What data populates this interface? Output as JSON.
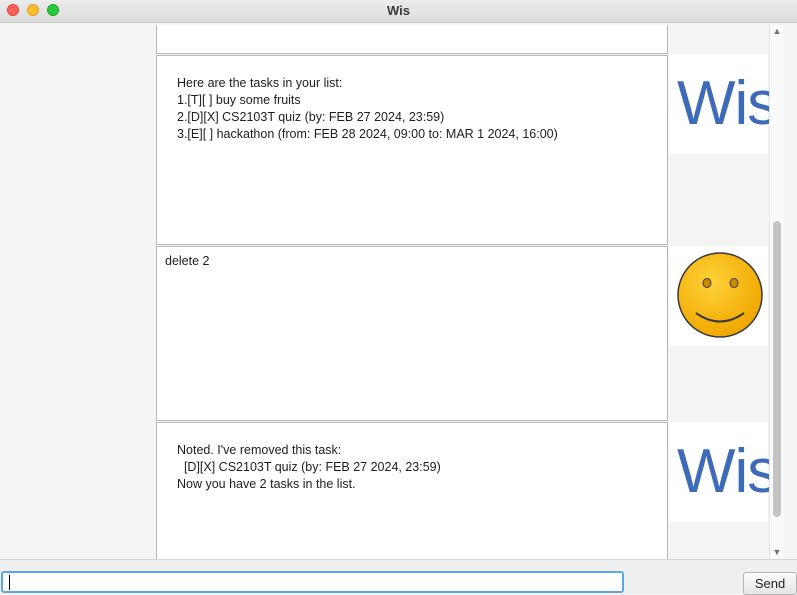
{
  "window": {
    "title": "Wis"
  },
  "rule_text": "____________________________________________________________",
  "messages": [
    {
      "type": "bot",
      "lines": []
    },
    {
      "type": "bot",
      "lines": [
        "Here are the tasks in your list:",
        "1.[T][ ] buy some fruits",
        "2.[D][X] CS2103T quiz (by: FEB 27 2024, 23:59)",
        "3.[E][ ] hackathon (from: FEB 28 2024, 09:00 to: MAR 1 2024, 16:00)"
      ]
    },
    {
      "type": "user",
      "text": "delete 2"
    },
    {
      "type": "bot",
      "lines": [
        "Noted. I've removed this task:",
        "  [D][X] CS2103T quiz (by: FEB 27 2024, 23:59)",
        "Now you have 2 tasks in the list."
      ]
    }
  ],
  "bot_avatar": {
    "logo_text": "Wis",
    "color": "#3d6bb8"
  },
  "user_avatar": {
    "icon": "smiley-face-icon",
    "color": "#f5b800"
  },
  "input": {
    "value": "",
    "placeholder": ""
  },
  "send_label": "Send",
  "icons": {
    "up": "▲",
    "down": "▼"
  }
}
